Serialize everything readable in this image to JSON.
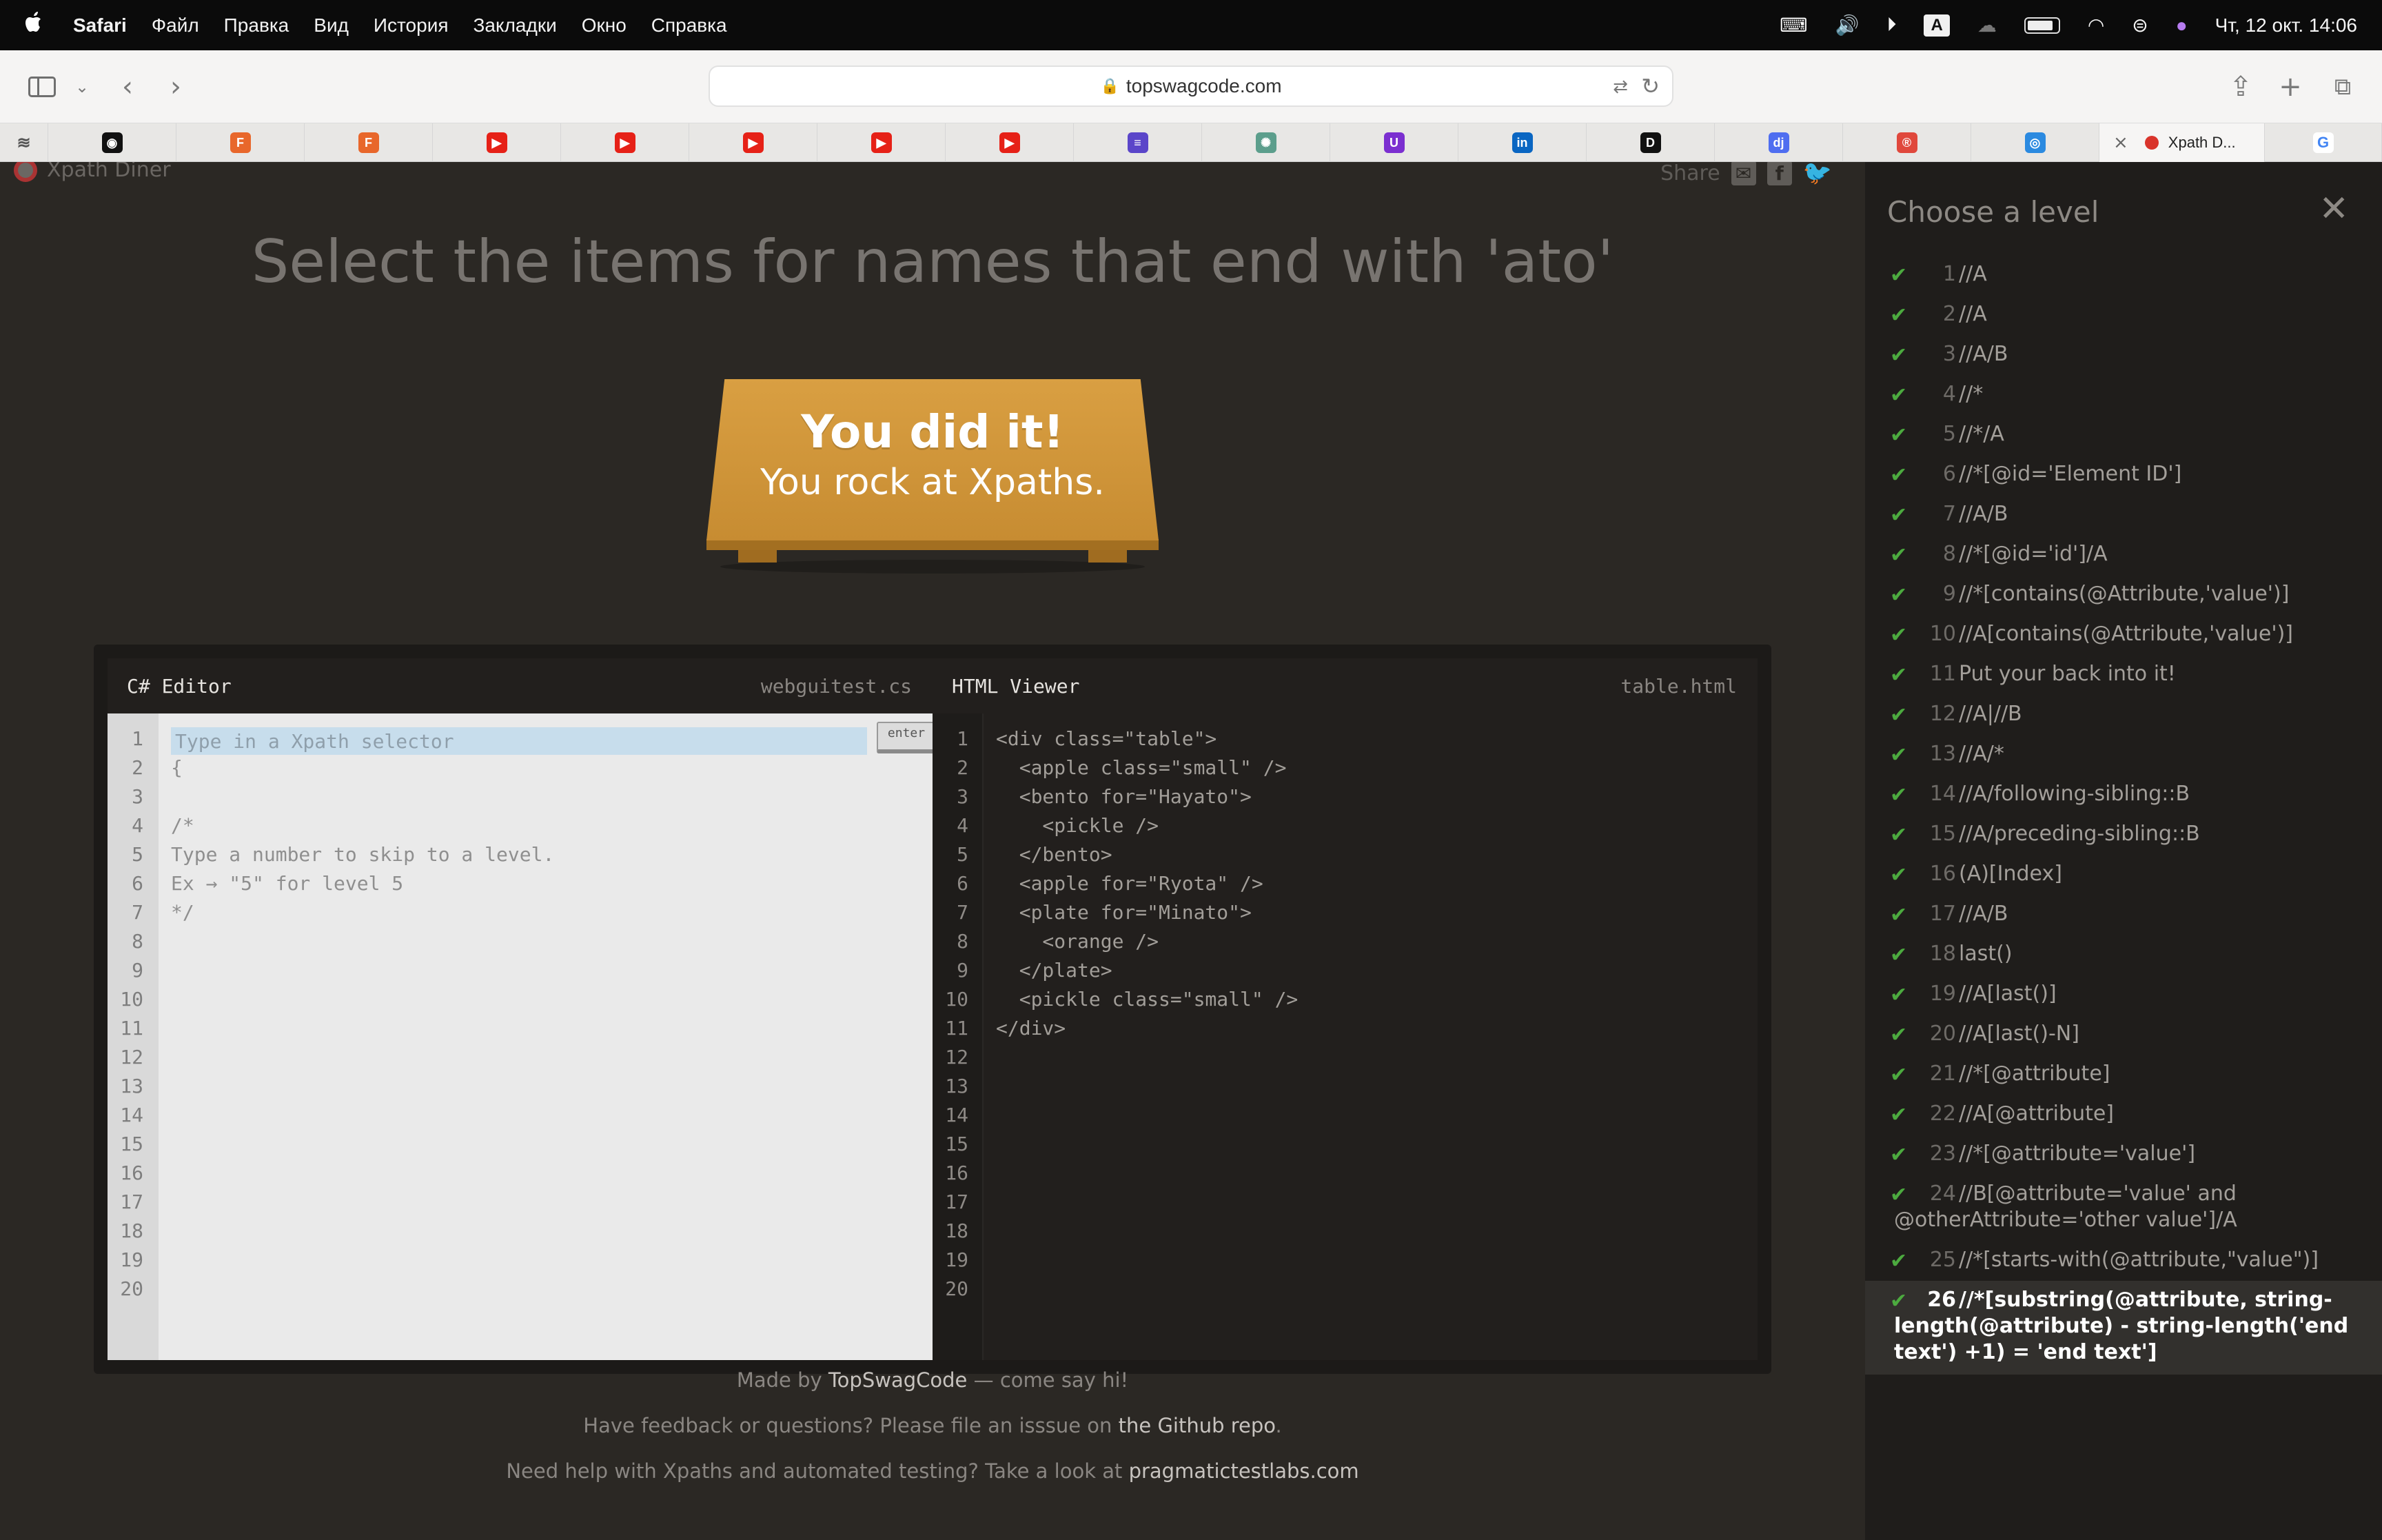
{
  "menubar": {
    "app": "Safari",
    "items": [
      "Файл",
      "Правка",
      "Вид",
      "История",
      "Закладки",
      "Окно",
      "Справка"
    ],
    "input_indicator": "A",
    "datetime": "Чт, 12 окт.  14:06"
  },
  "toolbar": {
    "url": "topswagcode.com"
  },
  "tabs": {
    "favicons": [
      {
        "icon": "github-icon",
        "color": "#111111",
        "glyph": "◉"
      },
      {
        "icon": "f-square-icon",
        "color": "#e8672b",
        "glyph": "F"
      },
      {
        "icon": "f-square-icon",
        "color": "#e8672b",
        "glyph": "F"
      },
      {
        "icon": "youtube-icon",
        "color": "#e62117",
        "glyph": "▶"
      },
      {
        "icon": "youtube-icon",
        "color": "#e62117",
        "glyph": "▶"
      },
      {
        "icon": "youtube-icon",
        "color": "#e62117",
        "glyph": "▶"
      },
      {
        "icon": "youtube-icon",
        "color": "#e62117",
        "glyph": "▶"
      },
      {
        "icon": "youtube-icon",
        "color": "#e62117",
        "glyph": "▶"
      },
      {
        "icon": "list-icon",
        "color": "#5b46c9",
        "glyph": "≡"
      },
      {
        "icon": "chatgpt-icon",
        "color": "#5c9e8c",
        "glyph": "✺"
      },
      {
        "icon": "u-circle-icon",
        "color": "#7b2fd0",
        "glyph": "U"
      },
      {
        "icon": "linkedin-icon",
        "color": "#0a66c2",
        "glyph": "in"
      },
      {
        "icon": "dou-icon",
        "color": "#111111",
        "glyph": "D"
      },
      {
        "icon": "djinni-icon",
        "color": "#4f6ef0",
        "glyph": "dj"
      },
      {
        "icon": "r-circle-icon",
        "color": "#e0483c",
        "glyph": "®"
      },
      {
        "icon": "ring-icon",
        "color": "#2b8ae0",
        "glyph": "◎"
      }
    ],
    "active_label": "Xpath D...",
    "last_icon": "google-icon"
  },
  "page": {
    "brand": "Xpath Diner",
    "share_label": "Share",
    "instruction": "Select the items for names that end with 'ato'",
    "win_title": "You did it!",
    "win_subtitle": "You rock at Xpaths."
  },
  "editor": {
    "title": "C# Editor",
    "file": "webguitest.cs",
    "placeholder": "Type in a Xpath selector",
    "enter_label": "enter",
    "lines": [
      "",
      "{",
      "",
      "/*",
      "Type a number to skip to a level.",
      "Ex → \"5\" for level 5",
      "*/"
    ],
    "line_count": 20
  },
  "viewer": {
    "title": "HTML Viewer",
    "file": "table.html",
    "lines": [
      "<div class=\"table\">",
      "  <apple class=\"small\" />",
      "  <bento for=\"Hayato\">",
      "    <pickle />",
      "  </bento>",
      "  <apple for=\"Ryota\" />",
      "  <plate for=\"Minato\">",
      "    <orange />",
      "  </plate>",
      "  <pickle class=\"small\" />",
      "</div>"
    ],
    "line_count": 20
  },
  "footer": {
    "line1_pre": "Made by ",
    "line1_link": "TopSwagCode",
    "line1_post": " — come say hi!",
    "line2_pre": "Have feedback or questions? Please file an isssue on ",
    "line2_link": "the Github repo",
    "line2_post": ".",
    "line3_pre": "Need help with Xpaths and automated testing? Take a look at ",
    "line3_link": "pragmatictestlabs.com"
  },
  "levels": {
    "title": "Choose a level",
    "items": [
      {
        "num": "1",
        "label": "//A"
      },
      {
        "num": "2",
        "label": "//A"
      },
      {
        "num": "3",
        "label": "//A/B"
      },
      {
        "num": "4",
        "label": "//*"
      },
      {
        "num": "5",
        "label": "//*/A"
      },
      {
        "num": "6",
        "label": "//*[@id='Element ID']"
      },
      {
        "num": "7",
        "label": "//A/B"
      },
      {
        "num": "8",
        "label": "//*[@id='id']/A"
      },
      {
        "num": "9",
        "label": "//*[contains(@Attribute,'value')]"
      },
      {
        "num": "10",
        "label": "//A[contains(@Attribute,'value')]"
      },
      {
        "num": "11",
        "label": "Put your back into it!"
      },
      {
        "num": "12",
        "label": "//A|//B"
      },
      {
        "num": "13",
        "label": "//A/*"
      },
      {
        "num": "14",
        "label": "//A/following-sibling::B"
      },
      {
        "num": "15",
        "label": "//A/preceding-sibling::B"
      },
      {
        "num": "16",
        "label": "(A)[Index]"
      },
      {
        "num": "17",
        "label": "//A/B"
      },
      {
        "num": "18",
        "label": "last()"
      },
      {
        "num": "19",
        "label": "//A[last()]"
      },
      {
        "num": "20",
        "label": "//A[last()-N]"
      },
      {
        "num": "21",
        "label": "//*[@attribute]"
      },
      {
        "num": "22",
        "label": "//A[@attribute]"
      },
      {
        "num": "23",
        "label": "//*[@attribute='value']"
      },
      {
        "num": "24",
        "label": "//B[@attribute='value' and @otherAttribute='other value']/A"
      },
      {
        "num": "25",
        "label": "//*[starts-with(@attribute,\"value\")]"
      },
      {
        "num": "26",
        "label": "//*[substring(@attribute, string-length(@attribute) - string-length('end text') +1) = 'end text']"
      }
    ],
    "current": "26",
    "check_color": "#4caa3f"
  }
}
